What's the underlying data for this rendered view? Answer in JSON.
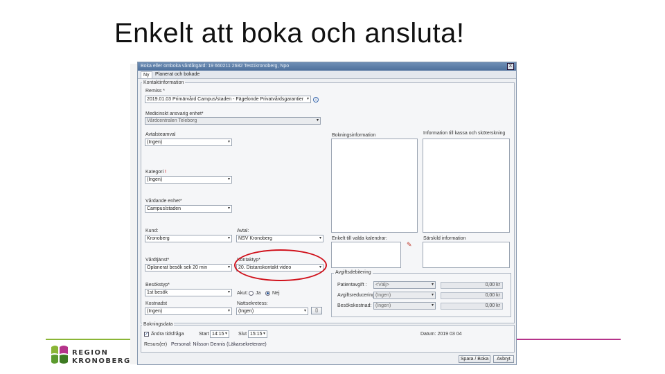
{
  "slide": {
    "title": "Enkelt att boka och ansluta!",
    "logo": {
      "line1": "REGION",
      "line2": "KRONOBERG"
    }
  },
  "window": {
    "title": "Boka eller omboka vårdåtgärd: 19 660211 2682 Test1kronoberg, Npo",
    "close_label": "X",
    "tabs": [
      {
        "label": "Ny"
      },
      {
        "label": "Planerat och bokade"
      }
    ]
  },
  "kontakt": {
    "group_label": "Kontaktinformation",
    "remiss_label": "Remiss *",
    "remiss_value": "2019.01.03 Primärvård Campus/staden - Fägelonde Privatvårdsgarantier",
    "medicinskt_label": "Medicinskt ansvarig enhet*",
    "medicinskt_value": "Vårdcentralen Teleborg",
    "avtal_label": "Avtalsteamval",
    "avtal_value": "(Ingen)",
    "kategori_label": "Kategori",
    "kategori_value": "(Ingen)",
    "vardande_label": "Vårdande enhet*",
    "vardande_value": "Campus/staden",
    "kund_label": "Kund:",
    "kund_value": "Kronoberg",
    "avtal2_label": "Avtal:",
    "avtal2_value": "NSV Kronoberg",
    "vardtjanst_label": "Vårdtjänst*",
    "vardtjanst_value": "Oplanerat besök sek 20 min",
    "kontaktyp_label": "Kontaktyp*",
    "kontaktyp_value": "20. Distanskontakt video",
    "besokstyp_label": "Besökstyp*",
    "besokstyp_value": "1st besök",
    "akut_label": "Akut:",
    "ja_label": "Ja",
    "nej_label": "Nej",
    "kostnadst_label": "Kostnadst",
    "kostnadst_value": "(Ingen)",
    "nattsekretess_label": "Nattsekretess:",
    "nattsekretess_value": "(Ingen)",
    "boknings_info_label": "Bokningsinformation",
    "info_kassa_label": "Information till kassa och sköterskning",
    "enkelt_label": "Enkelt till valda kalendrar:",
    "sarskild_label": "Särskild information"
  },
  "avgift": {
    "group_label": "Avgiftsdebitering",
    "patientavgift_label": "Patientavgift :",
    "patientavgift_value": "<Välj>",
    "patientavgift_amount": "0,00 kr",
    "avgiftsreducering_label": "Avgiftsreducering:",
    "avgiftsreducering_value": "(Ingen)",
    "avgiftsreducering_amount": "0,00 kr",
    "besokskostnad_label": "Besökskostnad:",
    "besokskostnad_value": "(Ingen)",
    "besokskostnad_amount": "0,00 kr"
  },
  "bokning": {
    "group_label": "Bokningsdata",
    "andra_label": "Ändra tidsfråga",
    "start_label": "Start",
    "start_value": "14:15",
    "slut_label": "Slut",
    "slut_value": "15:15",
    "datum_label": "Datum: 2019 03 04",
    "resurs_label": "Resurs(er)",
    "resurs_value": "Personal: Nilsson Dennis (Läkarsekreterare)"
  },
  "buttons": {
    "spara": "Spara / Boka",
    "avbryt": "Avbryt"
  },
  "colors": {
    "highlight": "#d0101a",
    "accent_left": "#8ab536",
    "accent_right": "#b5338a"
  }
}
